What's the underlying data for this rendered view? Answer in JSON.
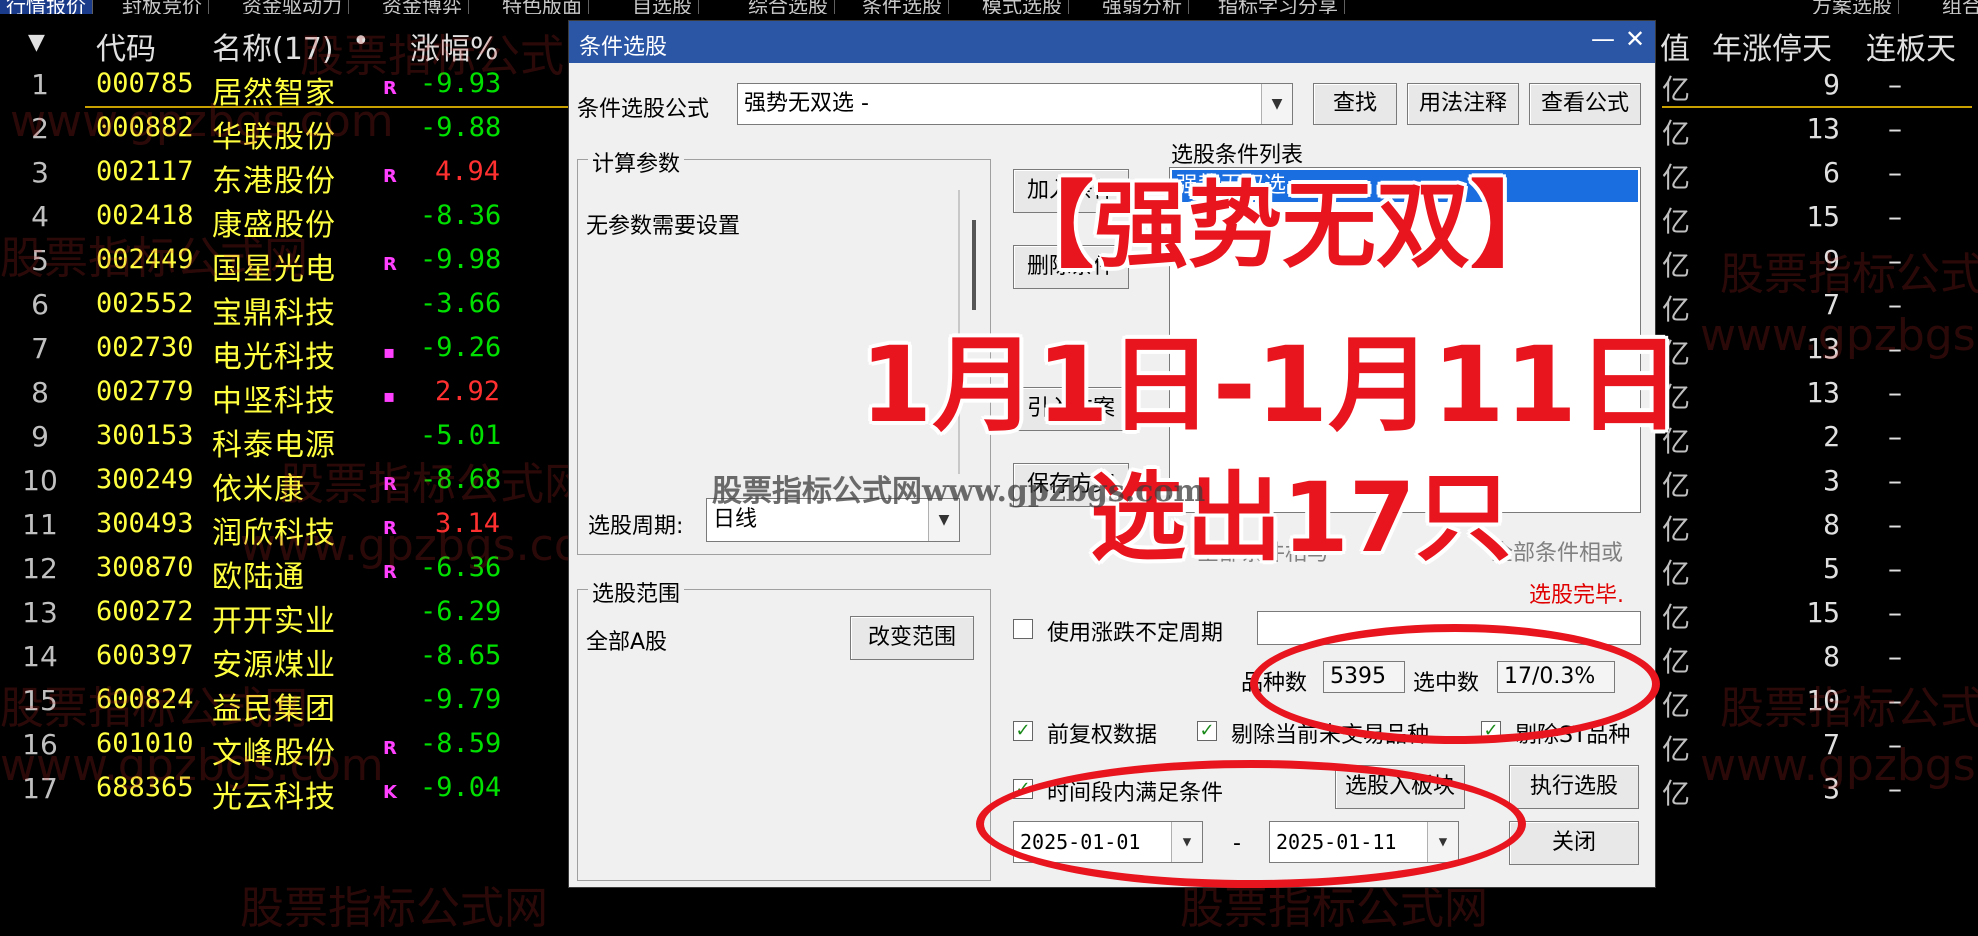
{
  "top_tabs": [
    "行情报价",
    "封板竞价",
    "资金驱动力",
    "资金博弈",
    "特色版面",
    "自选股",
    "综合选股",
    "条件选股",
    "模式选股",
    "强弱分析",
    "指标学习分享",
    "方案选股",
    "组合"
  ],
  "table": {
    "header": {
      "sort_arrow": "▼",
      "code": "代码",
      "name": "名称(17)",
      "dot": "•",
      "pct": "涨幅%",
      "value": "值",
      "year_limit_days": "年涨停天",
      "consec": "连板天"
    },
    "rows": [
      {
        "idx": "1",
        "code": "000785",
        "name": "居然智家",
        "flag": "R",
        "pct": "-9.93",
        "dir": "down",
        "yi": "亿",
        "days": "9",
        "lb": "–"
      },
      {
        "idx": "2",
        "code": "000882",
        "name": "华联股份",
        "flag": "",
        "pct": "-9.88",
        "dir": "down",
        "yi": "亿",
        "days": "13",
        "lb": "–"
      },
      {
        "idx": "3",
        "code": "002117",
        "name": "东港股份",
        "flag": "R",
        "pct": "4.94",
        "dir": "up",
        "yi": "亿",
        "days": "6",
        "lb": "–"
      },
      {
        "idx": "4",
        "code": "002418",
        "name": "康盛股份",
        "flag": "",
        "pct": "-8.36",
        "dir": "down",
        "yi": "亿",
        "days": "15",
        "lb": "–"
      },
      {
        "idx": "5",
        "code": "002449",
        "name": "国星光电",
        "flag": "R",
        "pct": "-9.98",
        "dir": "down",
        "yi": "亿",
        "days": "9",
        "lb": "–"
      },
      {
        "idx": "6",
        "code": "002552",
        "name": "宝鼎科技",
        "flag": "",
        "pct": "-3.66",
        "dir": "down",
        "yi": "亿",
        "days": "7",
        "lb": "–"
      },
      {
        "idx": "7",
        "code": "002730",
        "name": "电光科技",
        "flag": "▪",
        "pct": "-9.26",
        "dir": "down",
        "yi": "亿",
        "days": "13",
        "lb": "–"
      },
      {
        "idx": "8",
        "code": "002779",
        "name": "中坚科技",
        "flag": "▪",
        "pct": "2.92",
        "dir": "up",
        "yi": "亿",
        "days": "13",
        "lb": "–"
      },
      {
        "idx": "9",
        "code": "300153",
        "name": "科泰电源",
        "flag": "",
        "pct": "-5.01",
        "dir": "down",
        "yi": "亿",
        "days": "2",
        "lb": "–"
      },
      {
        "idx": "10",
        "code": "300249",
        "name": "依米康",
        "flag": "R",
        "pct": "-8.68",
        "dir": "down",
        "yi": "亿",
        "days": "3",
        "lb": "–"
      },
      {
        "idx": "11",
        "code": "300493",
        "name": "润欣科技",
        "flag": "R",
        "pct": "3.14",
        "dir": "up",
        "yi": "亿",
        "days": "8",
        "lb": "–"
      },
      {
        "idx": "12",
        "code": "300870",
        "name": "欧陆通",
        "flag": "R",
        "pct": "-6.36",
        "dir": "down",
        "yi": "亿",
        "days": "5",
        "lb": "–"
      },
      {
        "idx": "13",
        "code": "600272",
        "name": "开开实业",
        "flag": "",
        "pct": "-6.29",
        "dir": "down",
        "yi": "亿",
        "days": "15",
        "lb": "–"
      },
      {
        "idx": "14",
        "code": "600397",
        "name": "安源煤业",
        "flag": "",
        "pct": "-8.65",
        "dir": "down",
        "yi": "亿",
        "days": "8",
        "lb": "–"
      },
      {
        "idx": "15",
        "code": "600824",
        "name": "益民集团",
        "flag": "",
        "pct": "-9.79",
        "dir": "down",
        "yi": "亿",
        "days": "10",
        "lb": "–"
      },
      {
        "idx": "16",
        "code": "601010",
        "name": "文峰股份",
        "flag": "R",
        "pct": "-8.59",
        "dir": "down",
        "yi": "亿",
        "days": "7",
        "lb": "–"
      },
      {
        "idx": "17",
        "code": "688365",
        "name": "光云科技",
        "flag": "K",
        "pct": "-9.04",
        "dir": "down",
        "yi": "亿",
        "days": "3",
        "lb": "–"
      }
    ]
  },
  "dialog": {
    "title": "条件选股",
    "minimize": "—",
    "close": "✕",
    "formula_label": "条件选股公式",
    "formula_value": "强势无双选  -",
    "find_btn": "查找",
    "usage_btn": "用法注释",
    "view_formula_btn": "查看公式",
    "calc_params_title": "计算参数",
    "no_params": "无参数需要设置",
    "add_condition_btn": "加入条件",
    "delete_condition_btn": "删除条件",
    "import_plan_btn": "引入方案",
    "save_plan_btn": "保存方案",
    "condition_list_title": "选股条件列表",
    "condition_item": "强势无双选",
    "period_label": "选股周期:",
    "period_value": "日线",
    "and_label": "全部条件相与",
    "or_label": "全部条件相或",
    "done_status": "选股完毕.",
    "range_title": "选股范围",
    "range_value": "全部A股",
    "change_range_btn": "改变范围",
    "use_period_label": "使用涨跌不定周期",
    "count_label": "品种数",
    "count_value": "5395",
    "selected_label": "选中数",
    "selected_value": "17/0.3%",
    "fq_label": "前复权数据",
    "exclude_untraded_label": "剔除当前未交易品种",
    "exclude_st_label": "剔除ST品种",
    "time_range_label": "时间段内满足条件",
    "to_block_btn": "选股入板块",
    "execute_btn": "执行选股",
    "date_from": "2025-01-01",
    "date_sep": "-",
    "date_to": "2025-01-11",
    "close_btn": "关闭",
    "check_mark": "✓"
  },
  "overlay": {
    "title": "【强势无双】",
    "dates": "1月1日-1月11日",
    "result": "选出17只"
  },
  "watermarks": {
    "cn": "股票指标公式网",
    "url": "www.gpzbgs.com",
    "mixed": "股票指标公式网www.gpzbgs.com"
  },
  "colors": {
    "up": "#ff3030",
    "down": "#00e000",
    "code": "#ffff40",
    "title_bar": "#2b56a6",
    "overlay_red": "#e8141e"
  }
}
